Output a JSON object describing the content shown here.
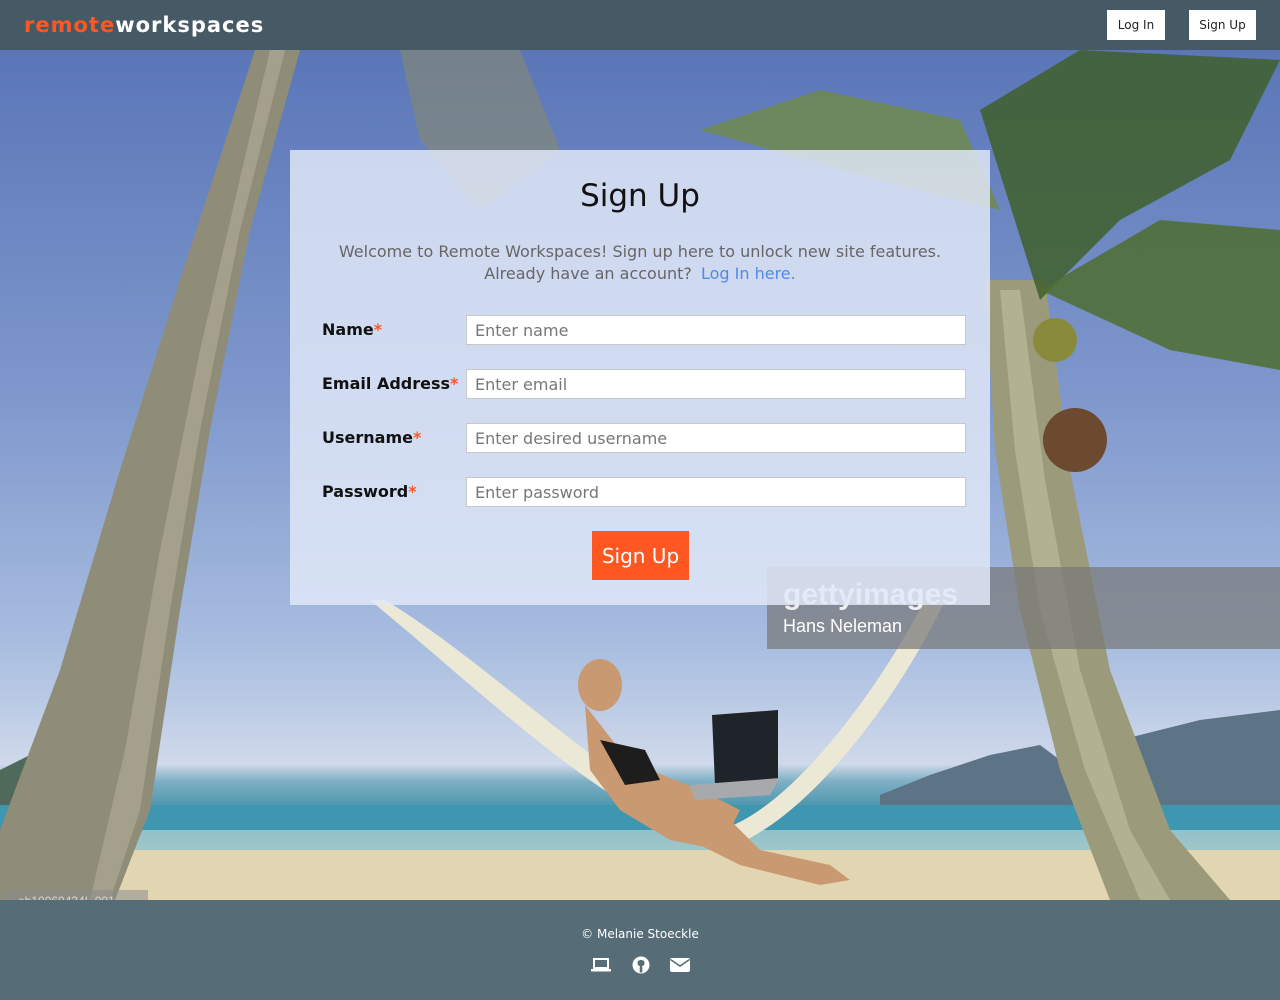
{
  "header": {
    "logo_part1": "remote",
    "logo_part2": "workspaces",
    "login_label": "Log In",
    "signup_label": "Sign Up"
  },
  "hero": {
    "watermark_brand": "gettyimages",
    "watermark_credit": "Hans Neleman",
    "photo_id": "ob10069434L.001"
  },
  "form": {
    "title": "Sign Up",
    "intro_line1": "Welcome to Remote Workspaces!  Sign up here to unlock new site features.",
    "intro_line2": "Already have an account?",
    "login_link": "Log In here.",
    "fields": [
      {
        "label": "Name",
        "placeholder": "Enter name",
        "value": ""
      },
      {
        "label": "Email Address",
        "placeholder": "Enter email",
        "value": ""
      },
      {
        "label": "Username",
        "placeholder": "Enter desired username",
        "value": ""
      },
      {
        "label": "Password",
        "placeholder": "Enter password",
        "value": ""
      }
    ],
    "required_mark": "*",
    "submit_label": "Sign Up"
  },
  "footer": {
    "copyright": "© Melanie Stoeckle",
    "icons": [
      "laptop-icon",
      "github-icon",
      "envelope-icon"
    ]
  },
  "colors": {
    "accent": "#ff5722",
    "header_bg": "#465a66",
    "footer_bg": "#566c77",
    "link": "#4f8be6"
  }
}
